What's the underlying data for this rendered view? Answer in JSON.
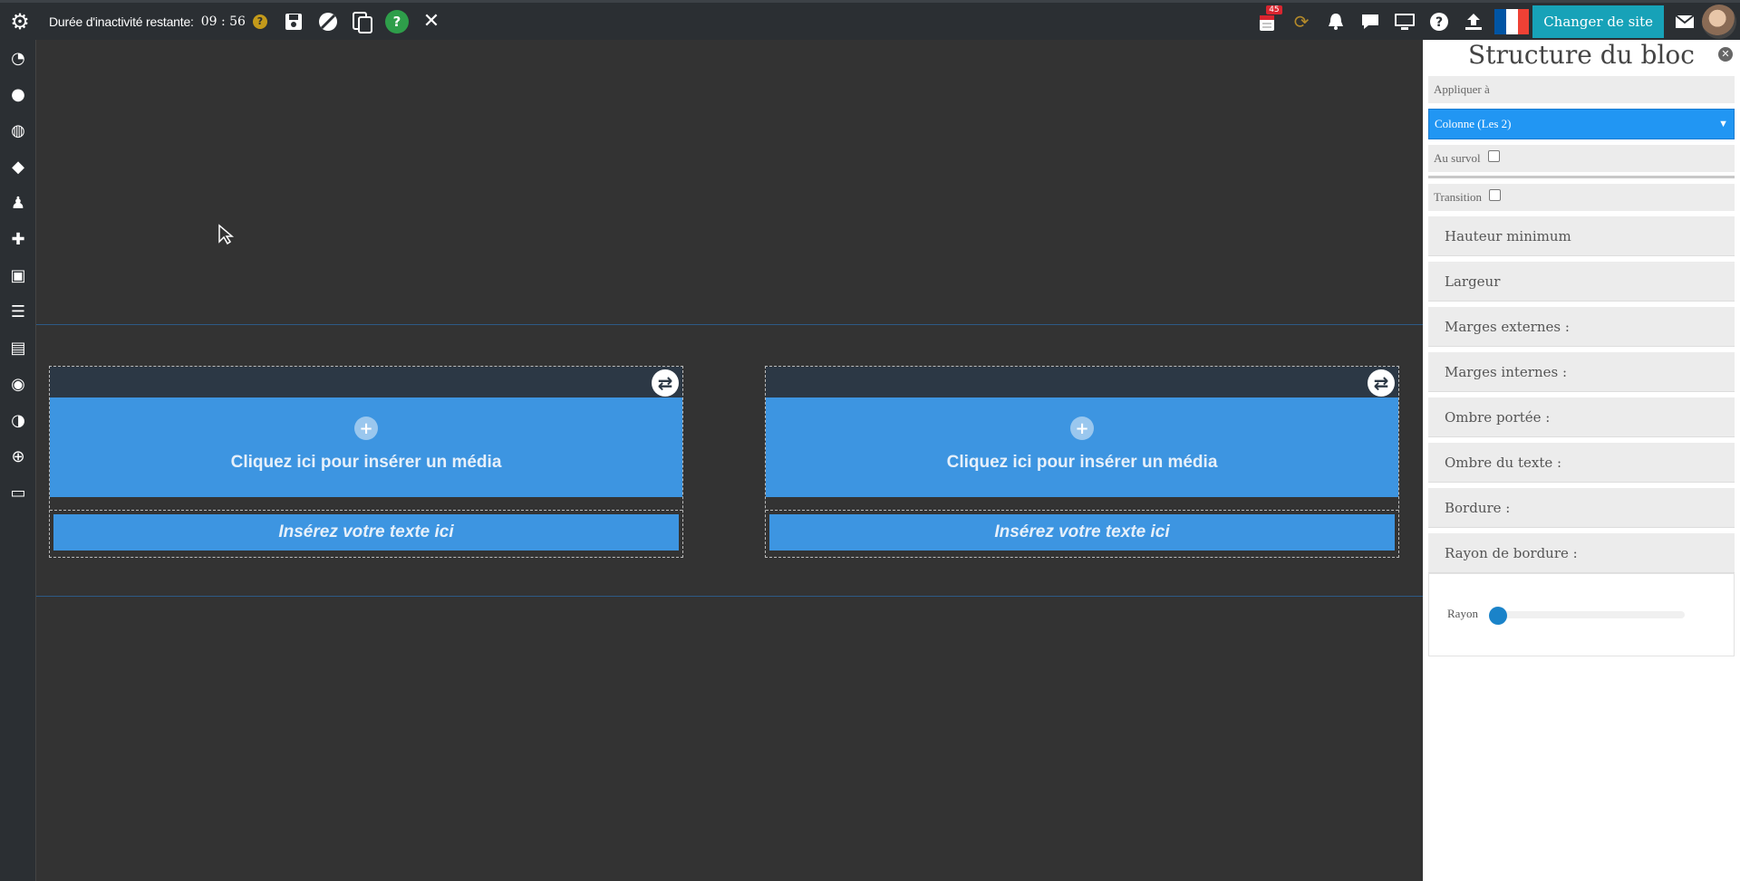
{
  "topbar": {
    "idle_label": "Durée d'inactivité restante:",
    "idle_timer": "09 : 56",
    "idle_help": "?",
    "help_glyph": "?",
    "notif_count": "45",
    "site_button": "Changer de site",
    "flag_colors": [
      "#0055a4",
      "#ffffff",
      "#ef4135"
    ]
  },
  "canvas": {
    "columns": [
      {
        "media_label": "Cliquez ici pour insérer un média",
        "text_label": "Insérez votre texte ici"
      },
      {
        "media_label": "Cliquez ici pour insérer un média",
        "text_label": "Insérez votre texte ici"
      }
    ]
  },
  "panel": {
    "title": "Structure du bloc",
    "apply_label": "Appliquer à",
    "apply_value": "Colonne (Les 2)",
    "hover_label": "Au survol",
    "transition_label": "Transition",
    "accordion": [
      "Hauteur minimum",
      "Largeur",
      "Marges externes :",
      "Marges internes :",
      "Ombre portée :",
      "Ombre du texte :",
      "Bordure :",
      "Rayon de bordure :"
    ],
    "radius_label": "Rayon",
    "radius_value": 0
  },
  "colors": {
    "accent": "#3d95e1",
    "select": "#2196f3",
    "site_button": "#17a2b8"
  }
}
